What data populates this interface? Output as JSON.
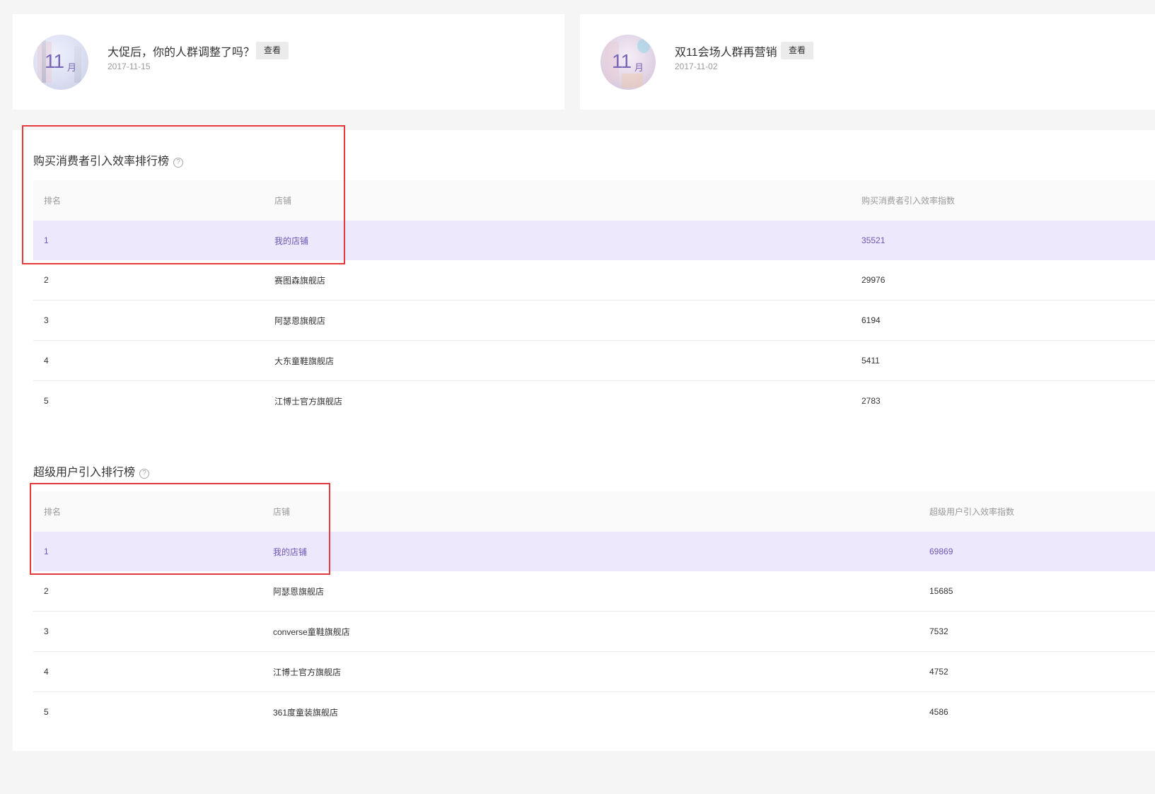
{
  "cards": [
    {
      "avatar": {
        "month_num": "11",
        "month_unit": "月"
      },
      "title": "大促后，你的人群调整了吗？",
      "button": "查看",
      "date": "2017-11-15"
    },
    {
      "avatar": {
        "month_num": "11",
        "month_unit": "月"
      },
      "title": "双11会场人群再营销",
      "button": "查看",
      "date": "2017-11-02"
    }
  ],
  "ranking_buyers": {
    "title": "购买消费者引入效率排行榜",
    "help": "?",
    "headers": [
      "排名",
      "店铺",
      "购买消费者引入效率指数"
    ],
    "rows": [
      [
        "1",
        "我的店铺",
        "35521"
      ],
      [
        "2",
        "赛图森旗舰店",
        "29976"
      ],
      [
        "3",
        "阿瑟恩旗舰店",
        "6194"
      ],
      [
        "4",
        "大东童鞋旗舰店",
        "5411"
      ],
      [
        "5",
        "江博士官方旗舰店",
        "2783"
      ]
    ]
  },
  "ranking_super": {
    "title": "超级用户引入排行榜",
    "help": "?",
    "headers": [
      "排名",
      "店铺",
      "超级用户引入效率指数"
    ],
    "rows": [
      [
        "1",
        "我的店铺",
        "69869"
      ],
      [
        "2",
        "阿瑟恩旗舰店",
        "15685"
      ],
      [
        "3",
        "converse童鞋旗舰店",
        "7532"
      ],
      [
        "4",
        "江博士官方旗舰店",
        "4752"
      ],
      [
        "5",
        "361度童装旗舰店",
        "4586"
      ]
    ]
  },
  "colors": {
    "accent": "#6a57b4",
    "highlight_row": "#eee8fd",
    "annotation_red": "#e5393c",
    "page_bg": "#f5f5f5"
  }
}
